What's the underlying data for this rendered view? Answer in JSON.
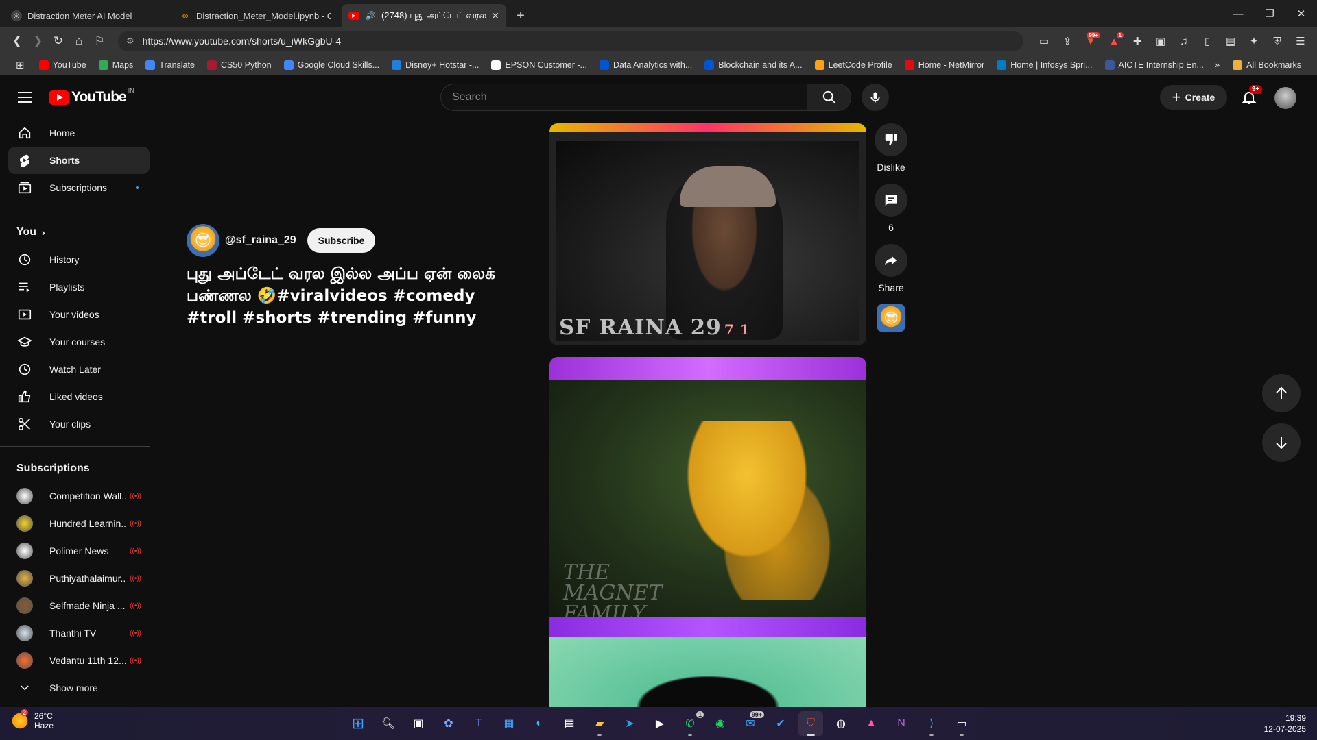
{
  "browser": {
    "tabs": [
      {
        "title": "Distraction Meter AI Model",
        "active": false
      },
      {
        "title": "Distraction_Meter_Model.ipynb - Col",
        "active": false
      },
      {
        "title": "(2748) புது அப்டேட் வரல",
        "active": true
      }
    ],
    "url": "https://www.youtube.com/shorts/u_iWkGgbU-4",
    "extension_badges": {
      "brave": "99+",
      "alert": "1"
    },
    "bookmarks": [
      {
        "label": "YouTube",
        "color": "#ff0000"
      },
      {
        "label": "Maps",
        "color": "#34a853"
      },
      {
        "label": "Translate",
        "color": "#4285f4"
      },
      {
        "label": "CS50 Python",
        "color": "#a51c30"
      },
      {
        "label": "Google Cloud Skills...",
        "color": "#4285f4"
      },
      {
        "label": "Disney+ Hotstar -...",
        "color": "#1f80e0"
      },
      {
        "label": "EPSON Customer -...",
        "color": "#ffffff"
      },
      {
        "label": "Data Analytics with...",
        "color": "#0056d2"
      },
      {
        "label": "Blockchain and its A...",
        "color": "#0056d2"
      },
      {
        "label": "LeetCode Profile",
        "color": "#ffa116"
      },
      {
        "label": "Home - NetMirror",
        "color": "#e50914"
      },
      {
        "label": "Home | Infosys Spri...",
        "color": "#007cc3"
      },
      {
        "label": "AICTE Internship En...",
        "color": "#3b5998"
      }
    ],
    "all_bookmarks": "All Bookmarks"
  },
  "header": {
    "logo_text": "YouTube",
    "country": "IN",
    "search_placeholder": "Search",
    "create_label": "Create",
    "notifications": "9+"
  },
  "sidebar": {
    "main": [
      {
        "label": "Home",
        "icon": "home-icon",
        "active": false
      },
      {
        "label": "Shorts",
        "icon": "shorts-icon",
        "active": true
      },
      {
        "label": "Subscriptions",
        "icon": "subscriptions-icon",
        "active": false
      }
    ],
    "you_label": "You",
    "you_items": [
      {
        "label": "History",
        "icon": "history-icon"
      },
      {
        "label": "Playlists",
        "icon": "playlists-icon"
      },
      {
        "label": "Your videos",
        "icon": "your-videos-icon"
      },
      {
        "label": "Your courses",
        "icon": "courses-icon"
      },
      {
        "label": "Watch Later",
        "icon": "watch-later-icon"
      },
      {
        "label": "Liked videos",
        "icon": "like-icon"
      },
      {
        "label": "Your clips",
        "icon": "clips-icon"
      }
    ],
    "subs_label": "Subscriptions",
    "subscriptions": [
      {
        "name": "Competition Wall...",
        "color": "#ffffff"
      },
      {
        "name": "Hundred Learnin...",
        "color": "#f7d21c"
      },
      {
        "name": "Polimer News",
        "color": "#ffffff"
      },
      {
        "name": "Puthiyathalaimur...",
        "color": "#e8b23c"
      },
      {
        "name": "Selfmade Ninja ...",
        "color": "#8b5a2b"
      },
      {
        "name": "Thanthi TV",
        "color": "#d6e3f0"
      },
      {
        "name": "Vedantu 11th 12...",
        "color": "#ff6a2a"
      }
    ],
    "show_more": "Show more"
  },
  "short": {
    "channel": "@sf_raina_29",
    "subscribe_label": "Subscribe",
    "title": "புது அப்டேட் வரல இல்ல அப்ப ஏன் லைக் பண்ணல 🤣#viralvideos #comedy #troll  #shorts #trending #funny",
    "watermark1": "SF RAINA 29",
    "watermark1_suffix": "7 1",
    "watermark2": "THE MAGNET FAMILY",
    "actions": {
      "dislike": "Dislike",
      "comments": "6",
      "share": "Share"
    }
  },
  "taskbar": {
    "temp": "26°C",
    "weather": "Haze",
    "weather_badge": "2",
    "whatsapp_badge": "1",
    "mail_badge": "99+",
    "time": "19:39",
    "date": "12-07-2025"
  }
}
